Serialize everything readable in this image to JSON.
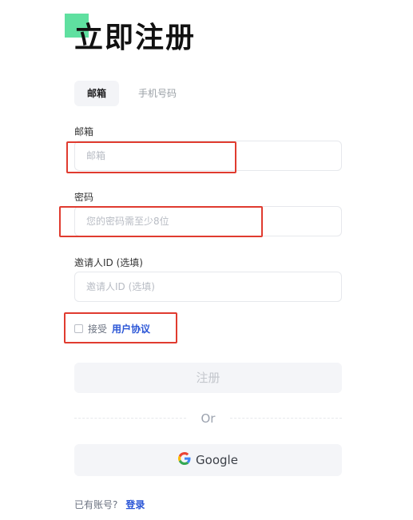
{
  "header": {
    "title": "立即注册"
  },
  "tabs": [
    {
      "label": "邮箱",
      "active": true
    },
    {
      "label": "手机号码",
      "active": false
    }
  ],
  "form": {
    "email": {
      "label": "邮箱",
      "placeholder": "邮箱",
      "value": ""
    },
    "password": {
      "label": "密码",
      "placeholder": "您的密码需至少8位",
      "value": ""
    },
    "referral": {
      "label": "邀请人ID (选填)",
      "placeholder": "邀请人ID (选填)",
      "value": ""
    },
    "agreement": {
      "checked": false,
      "text": "接受",
      "link": "用户协议"
    },
    "submit_label": "注册"
  },
  "divider_text": "Or",
  "google_button": {
    "label": "Google",
    "icon": "google-icon"
  },
  "footer": {
    "text": "已有账号?",
    "login_link": "登录"
  },
  "colors": {
    "accent": "#5fe0a0",
    "link": "#2a55d6",
    "highlight": "#e03b2f"
  }
}
